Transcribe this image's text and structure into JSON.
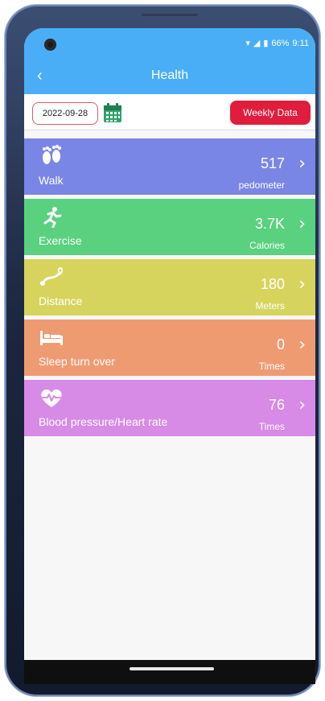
{
  "status_bar": {
    "battery": "66%",
    "time": "9:11"
  },
  "header": {
    "title": "Health",
    "back_icon": "chevron-left-icon"
  },
  "date_row": {
    "date": "2022-09-28",
    "weekly_button": "Weekly Data"
  },
  "cards": [
    {
      "label": "Walk",
      "value": "517",
      "unit": "pedometer",
      "color": "#7a86e6",
      "icon": "footprints-icon"
    },
    {
      "label": "Exercise",
      "value": "3.7K",
      "unit": "Calories",
      "color": "#59d17e",
      "icon": "running-icon"
    },
    {
      "label": "Distance",
      "value": "180",
      "unit": "Meters",
      "color": "#d6d45d",
      "icon": "route-icon"
    },
    {
      "label": "Sleep turn over",
      "value": "0",
      "unit": "Times",
      "color": "#ef9b72",
      "icon": "bed-icon"
    },
    {
      "label": "Blood pressure/Heart rate",
      "value": "76",
      "unit": "Times",
      "color": "#d78ae6",
      "icon": "heart-rate-icon"
    }
  ]
}
